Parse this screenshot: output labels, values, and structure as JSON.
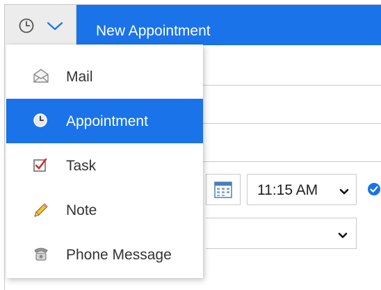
{
  "header": {
    "title": "New Appointment",
    "type_icon": "clock-icon",
    "dropdown_icon": "chevron-down-icon",
    "accent_color": "#1a73e8"
  },
  "menu": {
    "items": [
      {
        "label": "Mail",
        "icon": "mail-icon",
        "selected": false
      },
      {
        "label": "Appointment",
        "icon": "clock-icon",
        "selected": true
      },
      {
        "label": "Task",
        "icon": "task-check-icon",
        "selected": false
      },
      {
        "label": "Note",
        "icon": "pencil-icon",
        "selected": false
      },
      {
        "label": "Phone Message",
        "icon": "phone-icon",
        "selected": false
      }
    ]
  },
  "form": {
    "time_value": "11:15 AM",
    "calendar_icon": "calendar-icon",
    "check_icon": "check-circle-icon"
  }
}
